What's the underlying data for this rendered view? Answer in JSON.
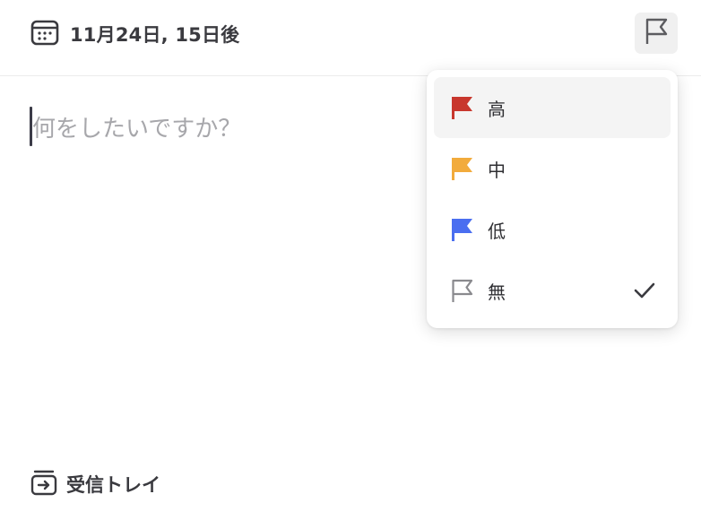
{
  "header": {
    "date_label": "11月24日, 15日後",
    "calendar_icon": "calendar-icon",
    "priority_icon": "flag-icon"
  },
  "editor": {
    "placeholder": "何をしたいですか？"
  },
  "priority_menu": {
    "items": [
      {
        "label": "高",
        "color": "#c8372d",
        "selected": false
      },
      {
        "label": "中",
        "color": "#f2ab3c",
        "selected": false
      },
      {
        "label": "低",
        "color": "#4a6ef0",
        "selected": false
      },
      {
        "label": "無",
        "color": "#8a8a8e",
        "selected": true
      }
    ]
  },
  "footer": {
    "project_label": "受信トレイ",
    "project_icon": "inbox-icon"
  }
}
